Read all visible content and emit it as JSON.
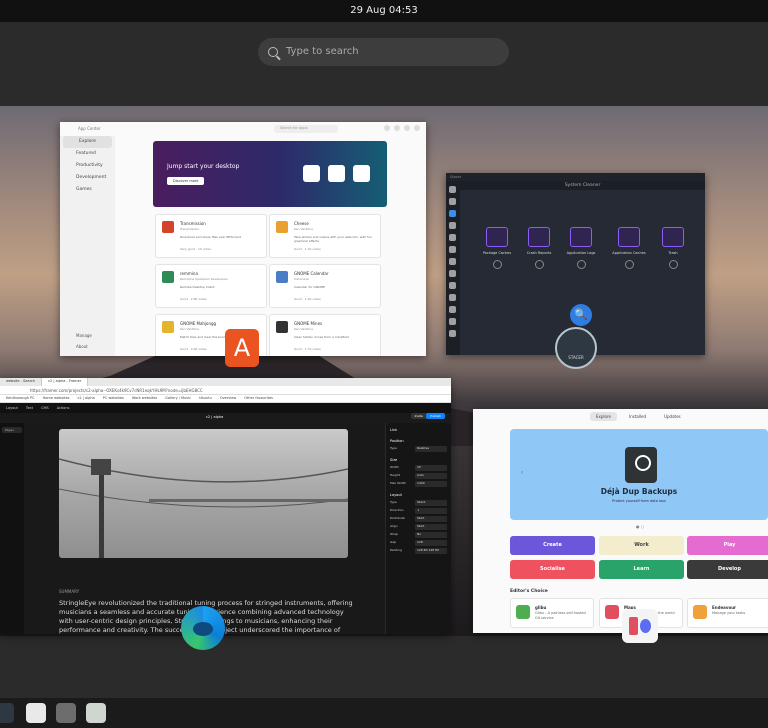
{
  "topbar": {
    "clock": "29 Aug  04:53"
  },
  "search": {
    "placeholder": "Type to search"
  },
  "app_center": {
    "title": "App Center",
    "search_placeholder": "Search for apps",
    "nav": [
      "Explore",
      "Featured",
      "Productivity",
      "Development",
      "Games"
    ],
    "bottom_nav": [
      "Manage",
      "About"
    ],
    "banner": {
      "title": "Jump start your desktop",
      "button": "Discover more"
    },
    "cards": [
      {
        "name": "Transmission",
        "publisher": "Transmission",
        "desc": "Download and share files over BitTorrent",
        "rating": "Very good · 10 votes",
        "color": "#d4442c"
      },
      {
        "name": "Cheese",
        "publisher": "Ken VanDine",
        "desc": "Take photos and videos with your webcam, with fun graphical effects",
        "rating": "Good · 1.1K votes",
        "color": "#e8a12f"
      },
      {
        "name": "remmina",
        "publisher": "Remmina Upstream Developers",
        "desc": "Remote Desktop Client",
        "rating": "Good · 2.8K votes",
        "color": "#2e8b57"
      },
      {
        "name": "GNOME Calendar",
        "publisher": "Canonical",
        "desc": "Calendar for GNOME",
        "rating": "Good · 1.4K votes",
        "color": "#4b7cc8"
      },
      {
        "name": "GNOME Mahjongg",
        "publisher": "Ken VanDine",
        "desc": "Match tiles and clear the board",
        "rating": "Good · 4.6K votes",
        "color": "#e4b429"
      },
      {
        "name": "GNOME Mines",
        "publisher": "Ken VanDine",
        "desc": "Clear hidden mines from a minefield",
        "rating": "Good · 1.7K votes",
        "color": "#333333"
      }
    ]
  },
  "stacer": {
    "window_title": "Stacer",
    "header": "System Cleaner",
    "options": [
      "Package Caches",
      "Crash Reports",
      "Application Logs",
      "Application Caches",
      "Trash"
    ],
    "badge": "STACER"
  },
  "browser": {
    "tabs": [
      "website - Search",
      "c2 | alpha - Framer"
    ],
    "url": "https://framer.com/projects/c2-alpha--OXEKs4k9Cv7cNR1eqkYHL9M?node=ljbEHG8CC",
    "bookmarks": [
      "Kenilborough PC",
      "Home websites",
      "c2 | alpha",
      "PC websites",
      "Work websites",
      "Gallery / Music",
      "Ubuntu",
      "Overview",
      "Other favourites"
    ],
    "toolbar": [
      "Layout",
      "Text",
      "CMS",
      "Actions"
    ],
    "project_title": "c2 | alpha",
    "invite": "Invite",
    "publish": "Publish",
    "left_panel": [
      "Pages"
    ],
    "summary_label": "SUMMARY",
    "paragraph": "StringleEye revolutionized the traditional tuning process for stringed instruments, offering musicians a seamless and accurate tuning experience combining advanced technology with user-centric design principles, StringleEye brings to musicians, enhancing their performance and creativity. The success of this project underscored the importance of innovation",
    "props": {
      "link": "Link",
      "position": "Position",
      "type": {
        "label": "Type",
        "value": "Relative"
      },
      "size": "Size",
      "width": {
        "label": "Width",
        "value": "1fr"
      },
      "height": {
        "label": "Height",
        "value": "Auto"
      },
      "max_width": {
        "label": "Max Width",
        "value": "1400"
      },
      "layout": "Layout",
      "layout_type": {
        "label": "Type",
        "value": "Stack"
      },
      "direction": {
        "label": "Direction",
        "value": "↓"
      },
      "distribute": {
        "label": "Distribute",
        "value": "Start"
      },
      "align": {
        "label": "Align",
        "value": "Start"
      },
      "wrap": {
        "label": "Wrap",
        "value": "No"
      },
      "gap": {
        "label": "Gap",
        "value": "128"
      },
      "padding": {
        "label": "Padding",
        "value": "128 80 128 80"
      }
    }
  },
  "software": {
    "tabs": [
      "Explore",
      "Installed",
      "Updates"
    ],
    "hero": {
      "name": "Déjà Dup Backups",
      "subtitle": "Protect yourself from data loss"
    },
    "categories": [
      {
        "label": "Create",
        "bg": "#6c56d9",
        "fg": "#ffffff"
      },
      {
        "label": "Work",
        "bg": "#f3eccd",
        "fg": "#444444"
      },
      {
        "label": "Play",
        "bg": "#e46bd0",
        "fg": "#ffffff"
      },
      {
        "label": "Socialise",
        "bg": "#f0515f",
        "fg": "#ffffff"
      },
      {
        "label": "Learn",
        "bg": "#2aa36a",
        "fg": "#ffffff"
      },
      {
        "label": "Develop",
        "bg": "#3a3a3a",
        "fg": "#ffffff"
      }
    ],
    "editors_choice": "Editor's Choice",
    "picks": [
      {
        "name": "glibu",
        "desc": "Glibu - A painless self-hosted Git service",
        "color": "#4cae4f"
      },
      {
        "name": "Maps",
        "desc": "Find places around the world",
        "color": "#e04f5f"
      },
      {
        "name": "Endeavour",
        "desc": "Manage your tasks",
        "color": "#f0a13c"
      }
    ]
  },
  "dock": [
    {
      "name": "stacer-dock-icon",
      "color": "#2e3842"
    },
    {
      "name": "app-grid-dock-icon",
      "color": "#e9e9e9"
    },
    {
      "name": "files-dock-icon",
      "color": "#6d6d6d"
    },
    {
      "name": "trash-dock-icon",
      "color": "#cfd6cf"
    }
  ]
}
